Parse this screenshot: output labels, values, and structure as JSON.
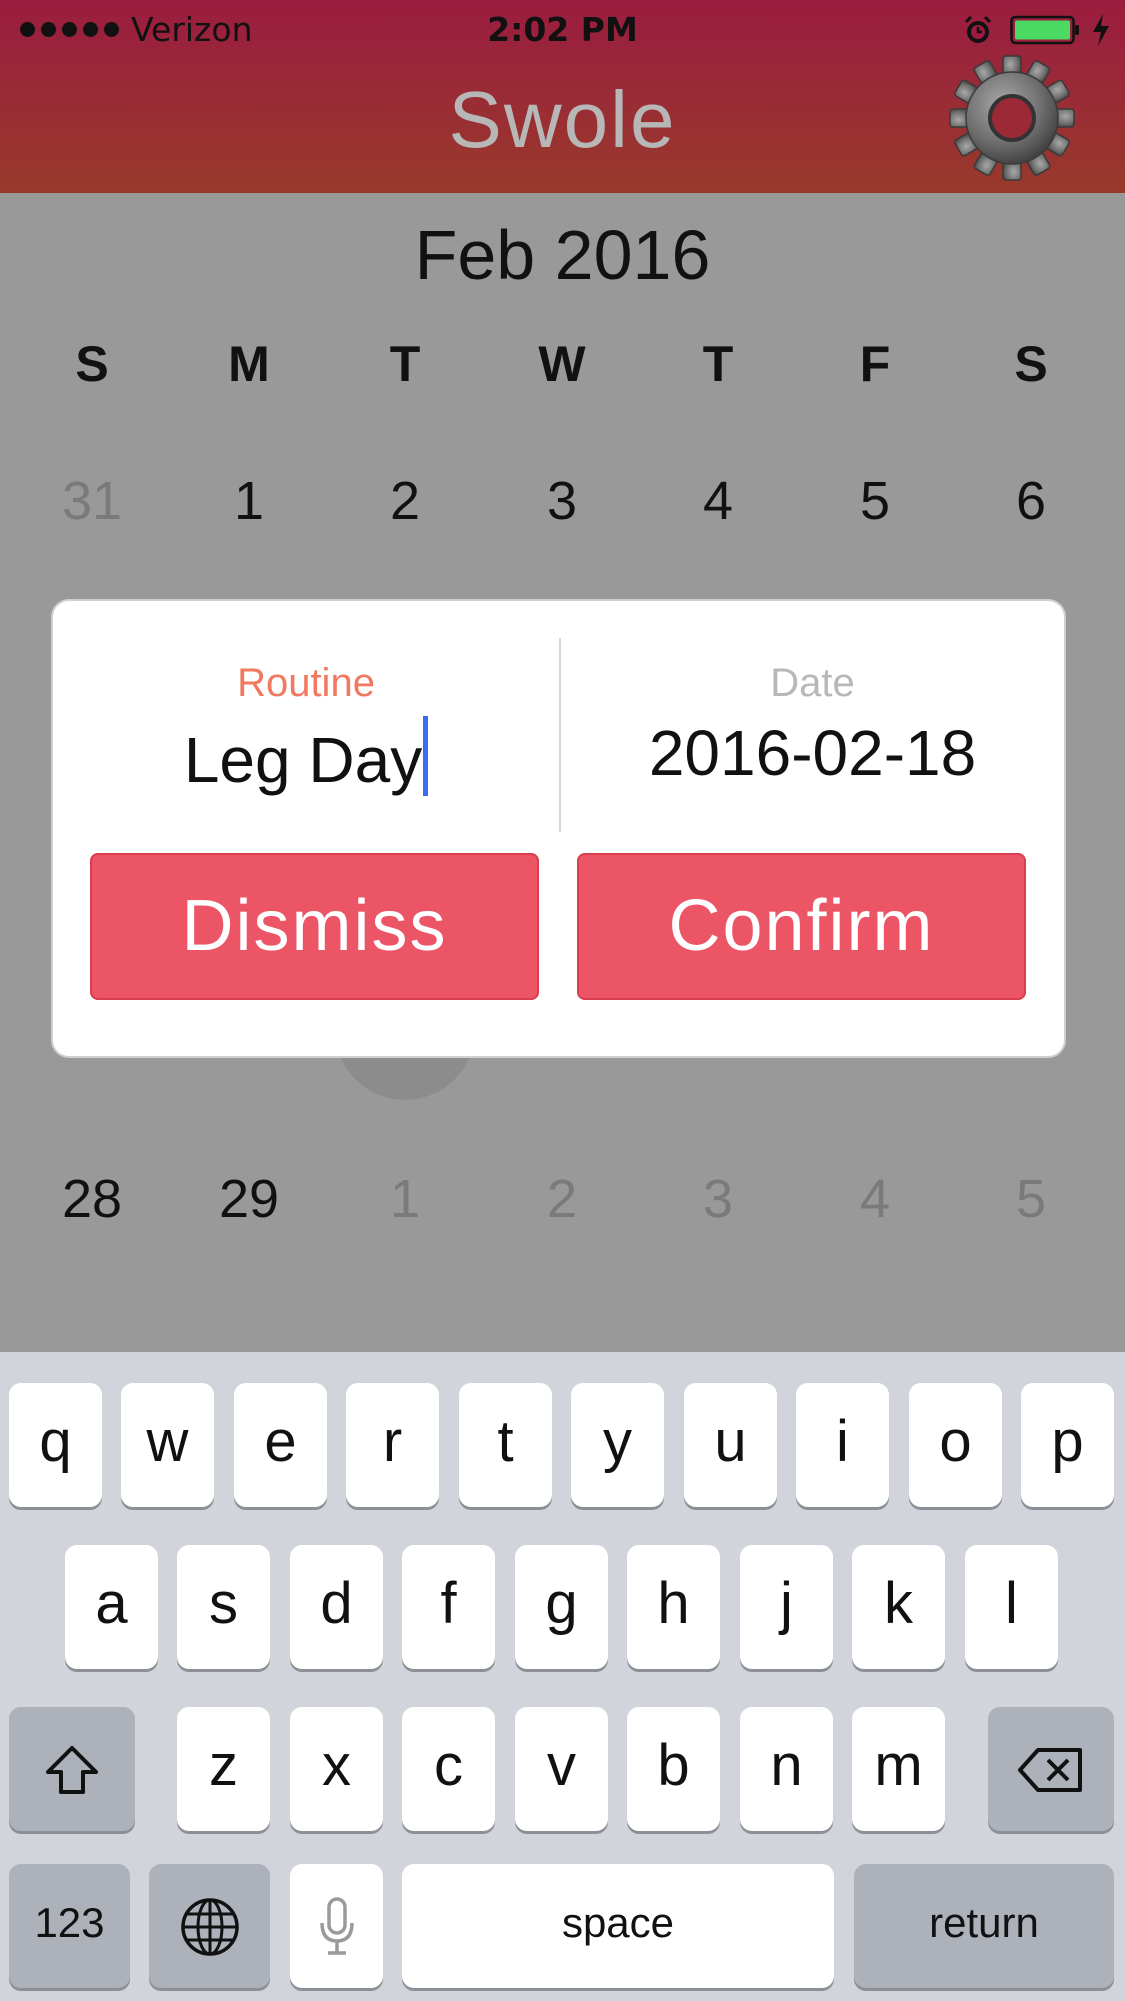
{
  "status_bar": {
    "carrier": "Verizon",
    "time": "2:02 PM",
    "battery_color": "#4cd964"
  },
  "app": {
    "title": "Swole",
    "settings_icon": "gear-icon"
  },
  "calendar": {
    "month_title": "Feb 2016",
    "weekdays": [
      "S",
      "M",
      "T",
      "W",
      "T",
      "F",
      "S"
    ],
    "week_first": [
      "31",
      "1",
      "2",
      "3",
      "4",
      "5",
      "6"
    ],
    "week_last": [
      "28",
      "29",
      "1",
      "2",
      "3",
      "4",
      "5"
    ]
  },
  "dialog": {
    "routine_label": "Routine",
    "routine_value": "Leg Day",
    "date_label": "Date",
    "date_value": "2016-02-18",
    "dismiss_label": "Dismiss",
    "confirm_label": "Confirm",
    "accent_color": "#ec5566",
    "label_color": "#f0795f"
  },
  "keyboard": {
    "row1": [
      "q",
      "w",
      "e",
      "r",
      "t",
      "y",
      "u",
      "i",
      "o",
      "p"
    ],
    "row2": [
      "a",
      "s",
      "d",
      "f",
      "g",
      "h",
      "j",
      "k",
      "l"
    ],
    "row3": [
      "z",
      "x",
      "c",
      "v",
      "b",
      "n",
      "m"
    ],
    "numbers_label": "123",
    "space_label": "space",
    "return_label": "return",
    "shift_icon": "shift-icon",
    "delete_icon": "delete-icon",
    "globe_icon": "globe-icon",
    "mic_icon": "microphone-icon"
  }
}
